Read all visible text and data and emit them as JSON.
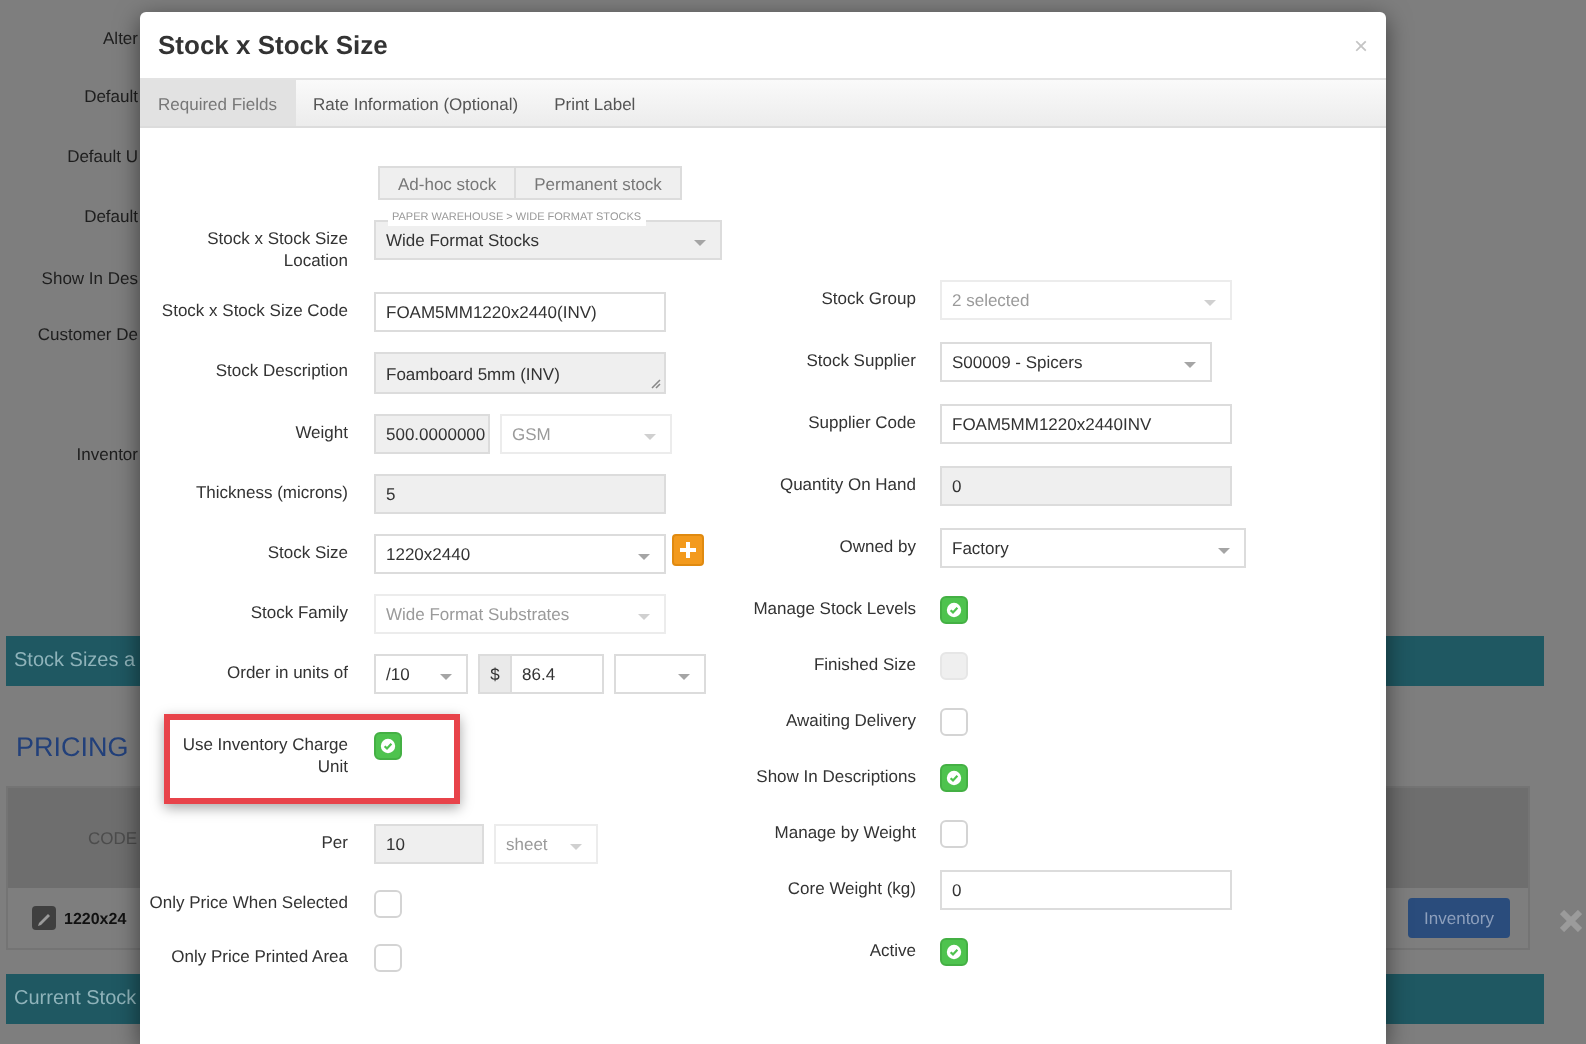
{
  "background": {
    "form_labels": [
      "Alter",
      "Default",
      "Default U",
      "Default",
      "Show In Des",
      "Customer De",
      "Inventor"
    ],
    "stock_sizes_bar": "Stock Sizes a",
    "pricing_heading": "PRICING",
    "pricing_table": {
      "column_1": "CODE",
      "row_code": "1220x24",
      "row_button": "Inventory"
    },
    "current_stock_bar": "Current Stock"
  },
  "modal": {
    "title": "Stock x Stock Size",
    "close": "×",
    "tabs": [
      {
        "label": "Required Fields",
        "selected": true
      },
      {
        "label": "Rate Information (Optional)",
        "selected": false
      },
      {
        "label": "Print Label",
        "selected": false
      }
    ],
    "stock_type_buttons": [
      {
        "label": "Ad-hoc stock",
        "selected": false
      },
      {
        "label": "Permanent stock",
        "selected": false
      }
    ],
    "left_fields": [
      {
        "label": "Stock x Stock Size Location",
        "controls": [
          {
            "kind": "select",
            "value": "Wide Format Stocks",
            "floating_label": "PAPER WAREHOUSE > WIDE FORMAT STOCKS",
            "readonly": true,
            "disabled": false
          }
        ]
      },
      {
        "label": "Stock x Stock Size Code",
        "controls": [
          {
            "kind": "input",
            "value": "FOAM5MM1220x2440(INV)",
            "disabled": false
          }
        ]
      },
      {
        "label": "Stock Description",
        "controls": [
          {
            "kind": "textarea",
            "value": "Foamboard 5mm (INV)",
            "disabled": true
          }
        ]
      },
      {
        "label": "Weight",
        "controls": [
          {
            "kind": "input",
            "value": "500.0000000",
            "disabled": true
          },
          {
            "kind": "select",
            "value": "GSM",
            "disabled": true
          }
        ]
      },
      {
        "label": "Thickness (microns)",
        "controls": [
          {
            "kind": "input",
            "value": "5",
            "disabled": true
          }
        ]
      },
      {
        "label": "Stock Size",
        "controls": [
          {
            "kind": "select",
            "value": "1220x2440",
            "disabled": false
          },
          {
            "kind": "add_button"
          }
        ]
      },
      {
        "label": "Stock Family",
        "controls": [
          {
            "kind": "select",
            "value": "Wide Format Substrates",
            "disabled": true
          }
        ]
      },
      {
        "label": "Order in units of",
        "controls": [
          {
            "kind": "select",
            "value": "/10",
            "disabled": false
          },
          {
            "kind": "addon",
            "value": "$"
          },
          {
            "kind": "input",
            "value": "86.4",
            "disabled": false
          },
          {
            "kind": "select",
            "disabled": false
          }
        ]
      },
      {
        "label": "Use Inventory Charge Unit",
        "highlighted": true,
        "controls": [
          {
            "kind": "checkbox",
            "checked": true,
            "disabled": false
          }
        ]
      },
      {
        "label": "Per",
        "controls": [
          {
            "kind": "input",
            "value": "10",
            "disabled": true
          },
          {
            "kind": "select",
            "value": "sheet",
            "disabled": true
          }
        ]
      },
      {
        "label": "Only Price When Selected",
        "controls": [
          {
            "kind": "checkbox",
            "checked": false,
            "disabled": false
          }
        ]
      },
      {
        "label": "Only Price Printed Area",
        "controls": [
          {
            "kind": "checkbox",
            "checked": false,
            "disabled": false
          }
        ]
      }
    ],
    "right_fields": [
      {
        "label": "Stock Group",
        "controls": [
          {
            "kind": "select",
            "value": "2 selected",
            "disabled": true
          }
        ]
      },
      {
        "label": "Stock Supplier",
        "controls": [
          {
            "kind": "select",
            "value": "S00009 - Spicers",
            "disabled": false
          }
        ]
      },
      {
        "label": "Supplier Code",
        "controls": [
          {
            "kind": "input",
            "value": "FOAM5MM1220x2440INV",
            "disabled": false
          }
        ]
      },
      {
        "label": "Quantity On Hand",
        "controls": [
          {
            "kind": "input",
            "value": "0",
            "disabled": true
          }
        ]
      },
      {
        "label": "Owned by",
        "controls": [
          {
            "kind": "select",
            "value": "Factory",
            "disabled": false
          }
        ]
      },
      {
        "label": "Manage Stock Levels",
        "controls": [
          {
            "kind": "checkbox",
            "checked": true,
            "disabled": false
          }
        ]
      },
      {
        "label": "Finished Size",
        "controls": [
          {
            "kind": "checkbox",
            "checked": false,
            "disabled": true
          }
        ]
      },
      {
        "label": "Awaiting Delivery",
        "controls": [
          {
            "kind": "checkbox",
            "checked": false,
            "disabled": false
          }
        ]
      },
      {
        "label": "Show In Descriptions",
        "controls": [
          {
            "kind": "checkbox",
            "checked": true,
            "disabled": false
          }
        ]
      },
      {
        "label": "Manage by Weight",
        "controls": [
          {
            "kind": "checkbox",
            "checked": false,
            "disabled": false
          }
        ]
      },
      {
        "label": "Core Weight (kg)",
        "controls": [
          {
            "kind": "input",
            "value": "0",
            "disabled": false
          }
        ]
      },
      {
        "label": "Active",
        "controls": [
          {
            "kind": "checkbox",
            "checked": true,
            "disabled": false
          }
        ]
      }
    ]
  }
}
